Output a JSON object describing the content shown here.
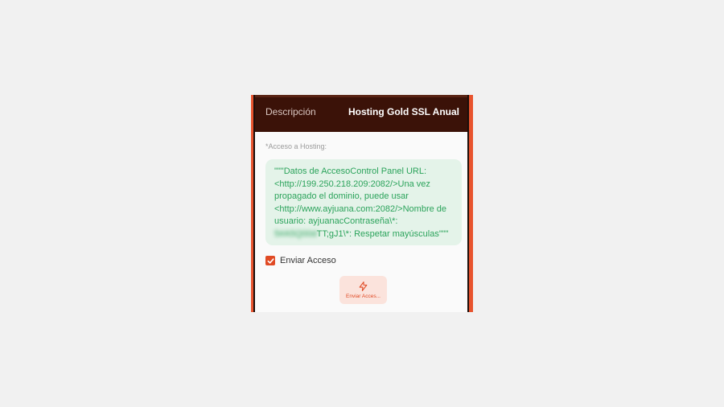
{
  "header": {
    "label": "Descripción",
    "value": "Hosting Gold SSL Anual"
  },
  "form": {
    "access_label": "*Acceso a Hosting:",
    "access_text_before": "\"\"\"Datos de AccesoControl Panel URL: <http://199.250.218.209:2082/>Una vez propagado el dominio, puede usar <http://www.ayjuana.com:2082/>Nombre de usuario: ayjuanacContraseña\\*: ",
    "access_text_blurred": "5#A5Q00d",
    "access_text_after": "TT;gJ1\\*: Respetar mayúsculas\"\"\"",
    "checkbox_label": "Enviar Acceso",
    "checkbox_checked": true,
    "button_label": "Enviar Acces..."
  },
  "colors": {
    "accent": "#e04a24",
    "header_bg": "#3b1208",
    "access_bg": "#e4f3e9",
    "access_text": "#2ba35b"
  },
  "icons": {
    "checkbox": "check-icon",
    "button": "lightning-icon"
  }
}
